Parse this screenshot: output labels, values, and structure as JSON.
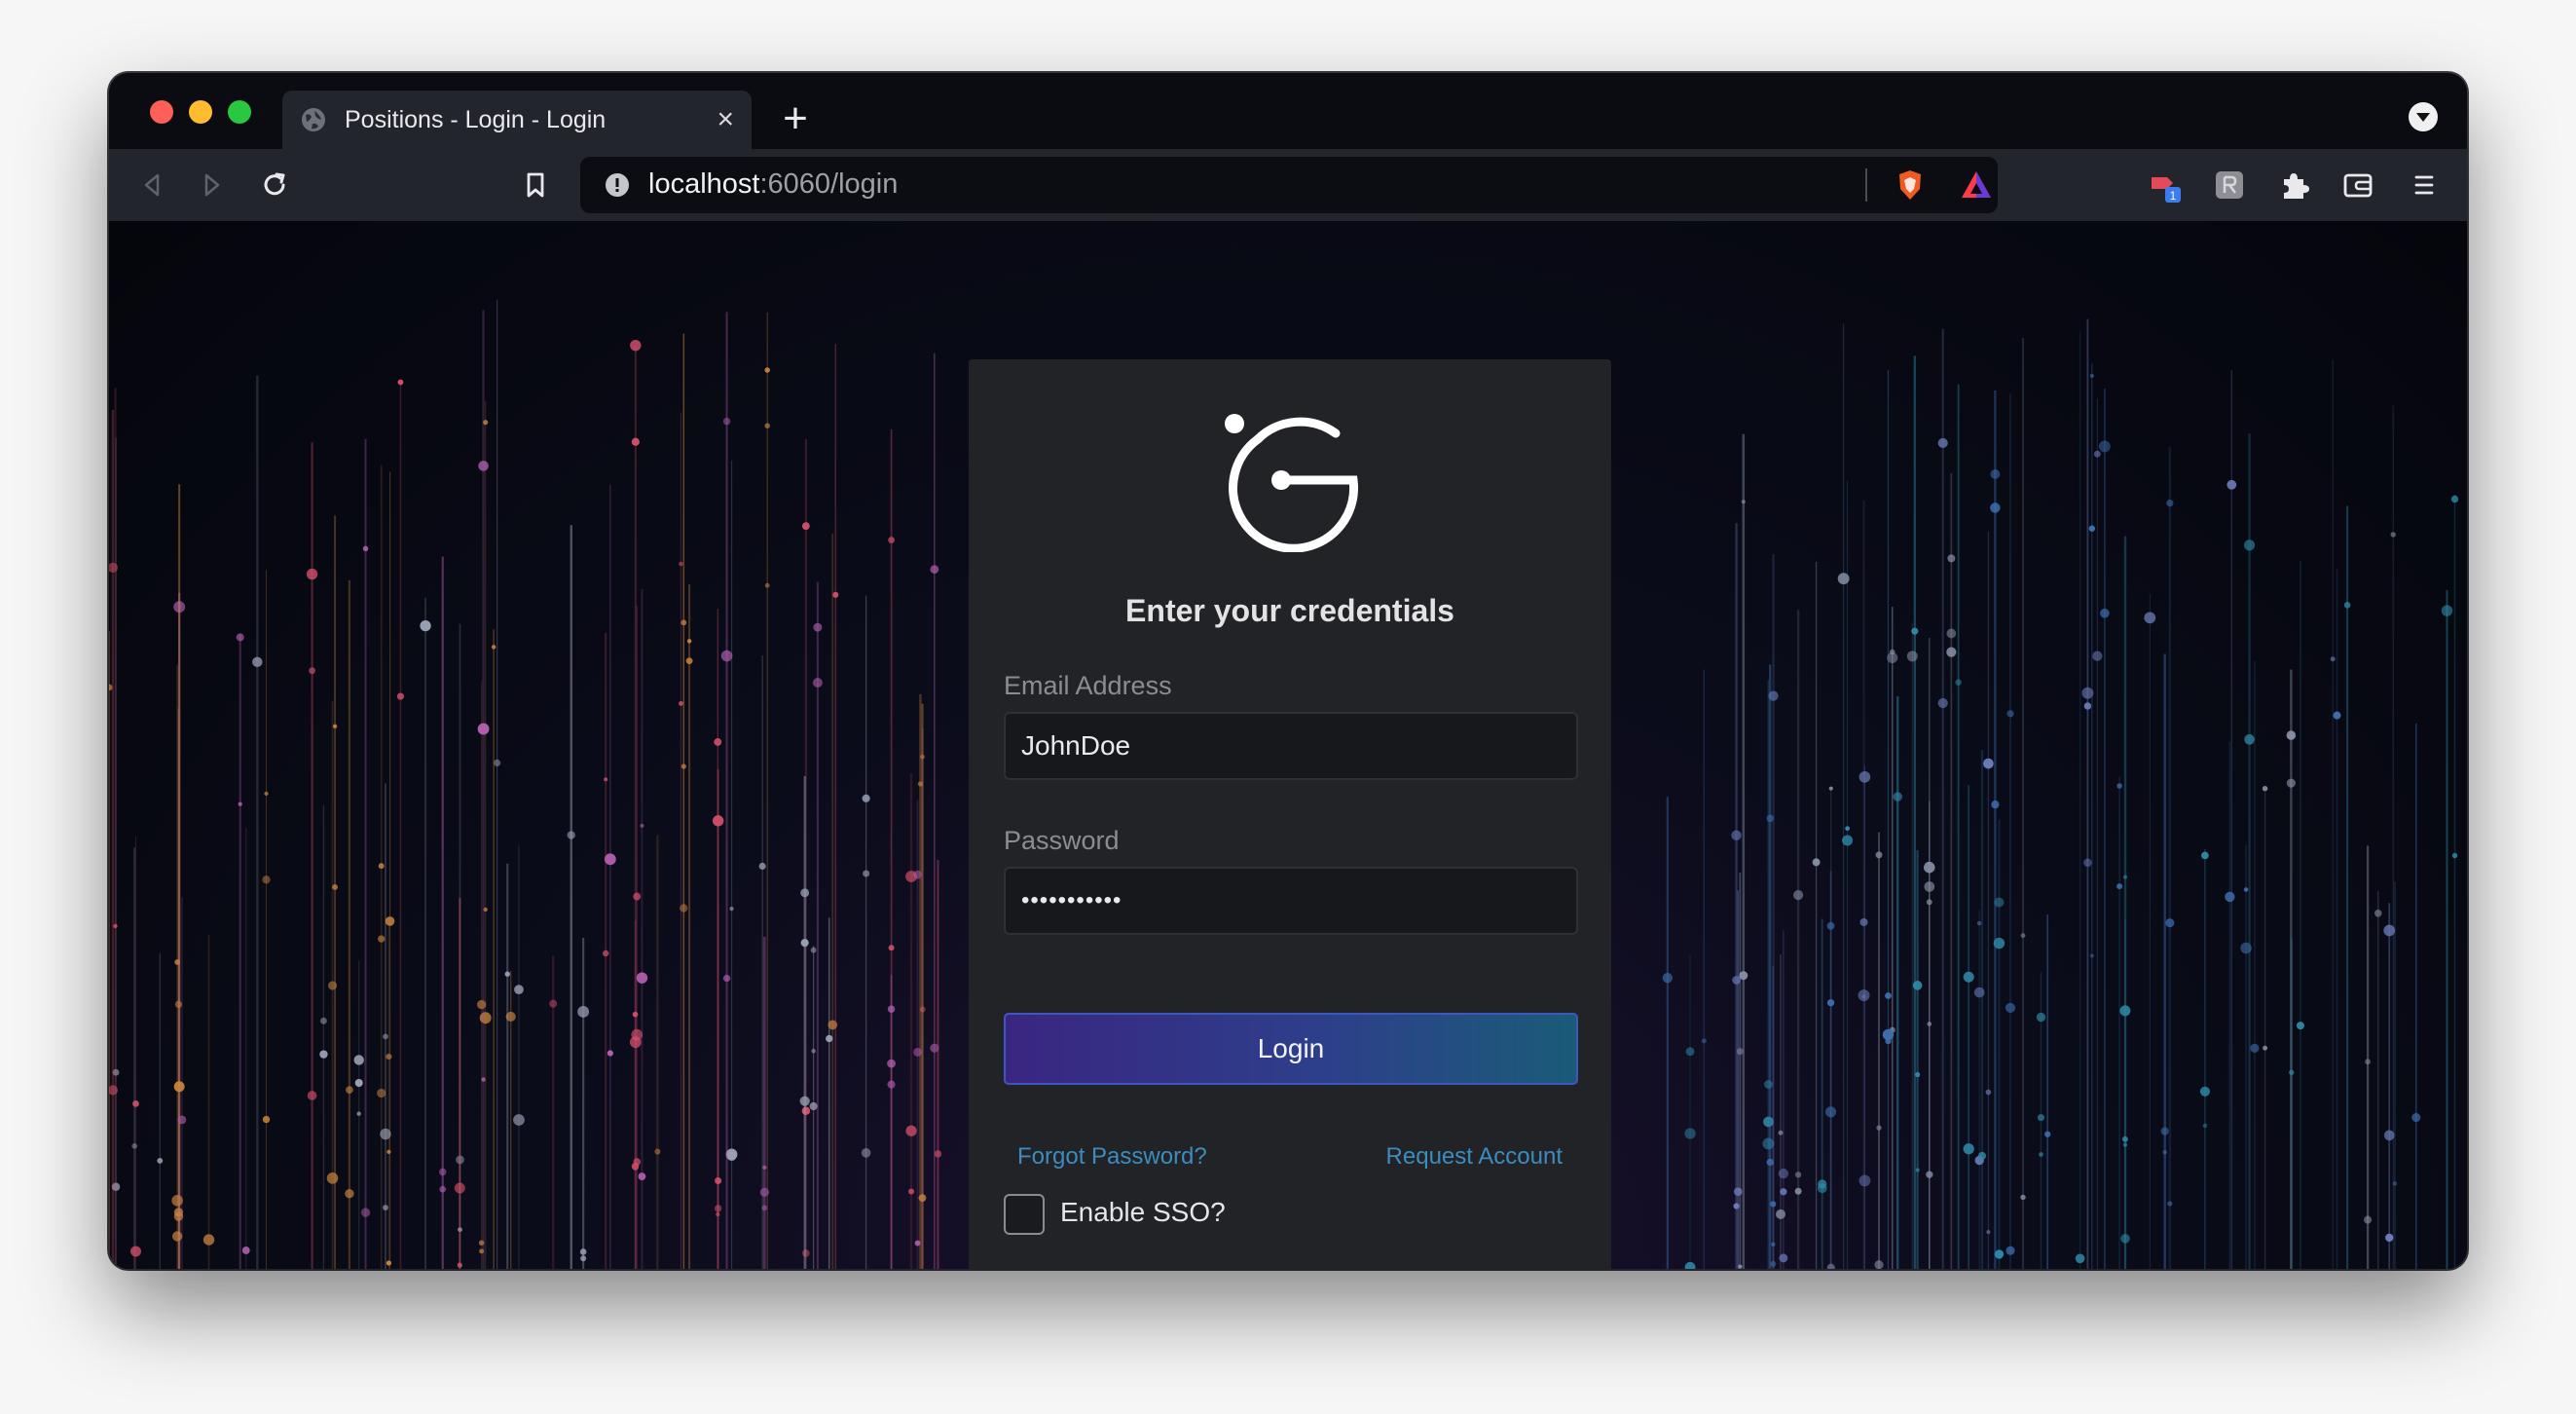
{
  "browser": {
    "tab_title": "Positions - Login - Login",
    "url_host": "localhost",
    "url_path": ":6060/login",
    "extension_badge": "1"
  },
  "login": {
    "heading": "Enter your credentials",
    "email_label": "Email Address",
    "email_value": "JohnDoe",
    "password_label": "Password",
    "password_value": "•••••••••••",
    "login_button": "Login",
    "forgot_password": "Forgot Password?",
    "request_account": "Request Account",
    "sso_label": "Enable SSO?",
    "sso_checked": false
  },
  "colors": {
    "accent_link": "#3d8cbf",
    "button_start": "#3a2682",
    "button_end": "#1a5b78",
    "card_bg": "#222327"
  },
  "icons": [
    "back-icon",
    "forward-icon",
    "reload-icon",
    "bookmark-icon",
    "site-info-icon",
    "brave-shields-icon",
    "brave-rewards-icon",
    "extension-icon",
    "puzzle-icon",
    "wallet-icon",
    "menu-icon",
    "globe-icon",
    "close-icon",
    "plus-icon",
    "logo"
  ]
}
